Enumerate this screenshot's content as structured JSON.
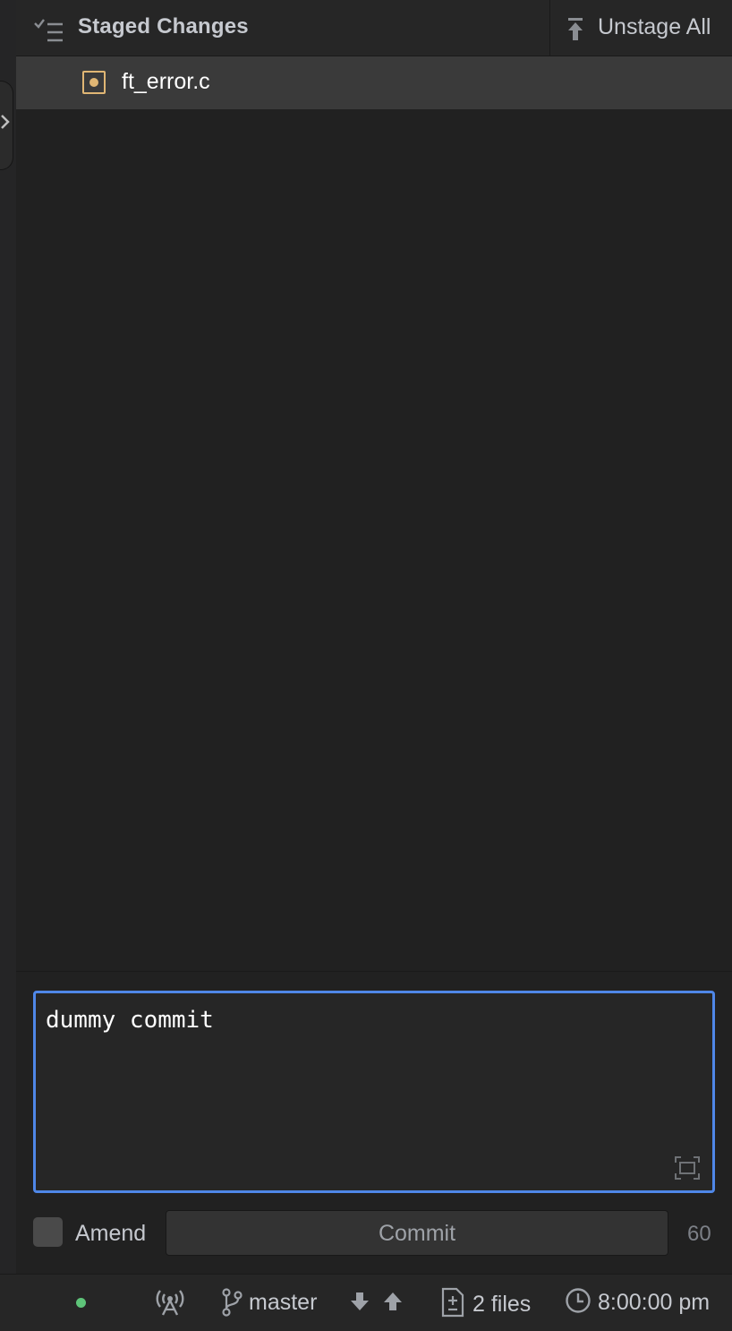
{
  "header": {
    "title": "Staged Changes",
    "unstage_all_label": "Unstage All",
    "icons": [
      "list-check-icon",
      "unstage-all-icon"
    ]
  },
  "files": [
    {
      "name": "ft_error.c",
      "status": "modified",
      "status_color": "#e0b674"
    }
  ],
  "commit": {
    "message": "dummy commit",
    "amend_label": "Amend",
    "amend_checked": false,
    "button_label": "Commit",
    "remaining_chars": "60",
    "focus_color": "#4f87e8"
  },
  "status_bar": {
    "status_dot_color": "#5ec479",
    "branch": "master",
    "files_changed": "2 files",
    "time": "8:00:00 pm",
    "icons": [
      "antenna-icon",
      "branch-icon",
      "fetch-down-icon",
      "push-up-icon",
      "diff-file-icon",
      "clock-icon"
    ]
  }
}
